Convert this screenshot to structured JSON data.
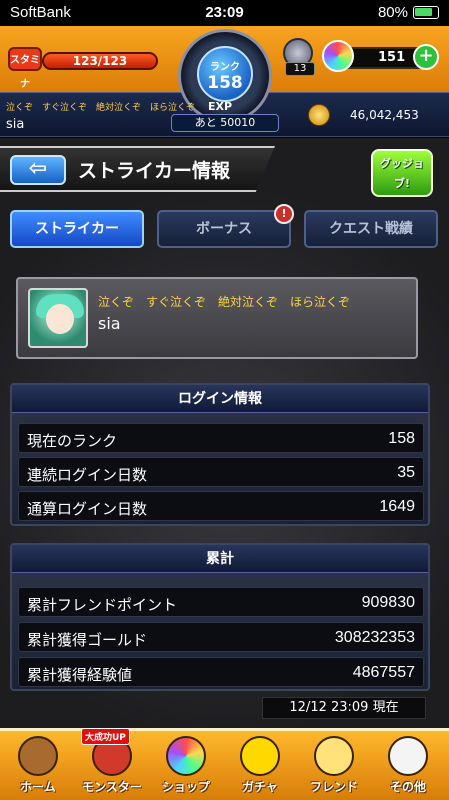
{
  "status_bar": {
    "carrier": "SoftBank",
    "time": "23:09",
    "battery": "80%"
  },
  "hud": {
    "stamina_label": "スタミナ",
    "stamina_value": "123/123",
    "rank_label": "ランク",
    "rank_value": "158",
    "exp_label": "EXP",
    "exp_remaining": "あと 50010",
    "ore_count": "13",
    "gem_count": "151",
    "plus_symbol": "+",
    "comment": "泣くぞ　すぐ泣くぞ　絶対泣くぞ　ほら泣くぞ",
    "player_name": "sia",
    "coins": "46,042,453"
  },
  "header": {
    "back_symbol": "⇦",
    "title": "ストライカー情報",
    "good_job": "グッジョブ!"
  },
  "tabs": [
    {
      "label": "ストライカー",
      "active": true
    },
    {
      "label": "ボーナス",
      "active": false
    },
    {
      "label": "クエスト戦績",
      "active": false
    }
  ],
  "tab_badge": "!",
  "profile": {
    "comment": "泣くぞ　すぐ泣くぞ　絶対泣くぞ　ほら泣くぞ",
    "name": "sia"
  },
  "login_info": {
    "title": "ログイン情報",
    "rows": [
      {
        "label": "現在のランク",
        "value": "158"
      },
      {
        "label": "連続ログイン日数",
        "value": "35"
      },
      {
        "label": "通算ログイン日数",
        "value": "1649"
      }
    ]
  },
  "totals": {
    "title": "累計",
    "rows": [
      {
        "label": "累計フレンドポイント",
        "value": "909830"
      },
      {
        "label": "累計獲得ゴールド",
        "value": "308232353"
      },
      {
        "label": "累計獲得経験値",
        "value": "4867557"
      }
    ]
  },
  "timestamp": "12/12 23:09 現在",
  "nav": [
    {
      "label": "ホーム",
      "icon": "home-icon",
      "color": "#a86a2e"
    },
    {
      "label": "モンスター",
      "icon": "monster-icon",
      "color": "#d13a2a",
      "badge": "大成功UP"
    },
    {
      "label": "ショップ",
      "icon": "shop-icon",
      "color": "#7fd0ff"
    },
    {
      "label": "ガチャ",
      "icon": "gacha-icon",
      "color": "#ffd800"
    },
    {
      "label": "フレンド",
      "icon": "friend-icon",
      "color": "#ffe27a"
    },
    {
      "label": "その他",
      "icon": "other-icon",
      "color": "#f4f4f4"
    }
  ]
}
